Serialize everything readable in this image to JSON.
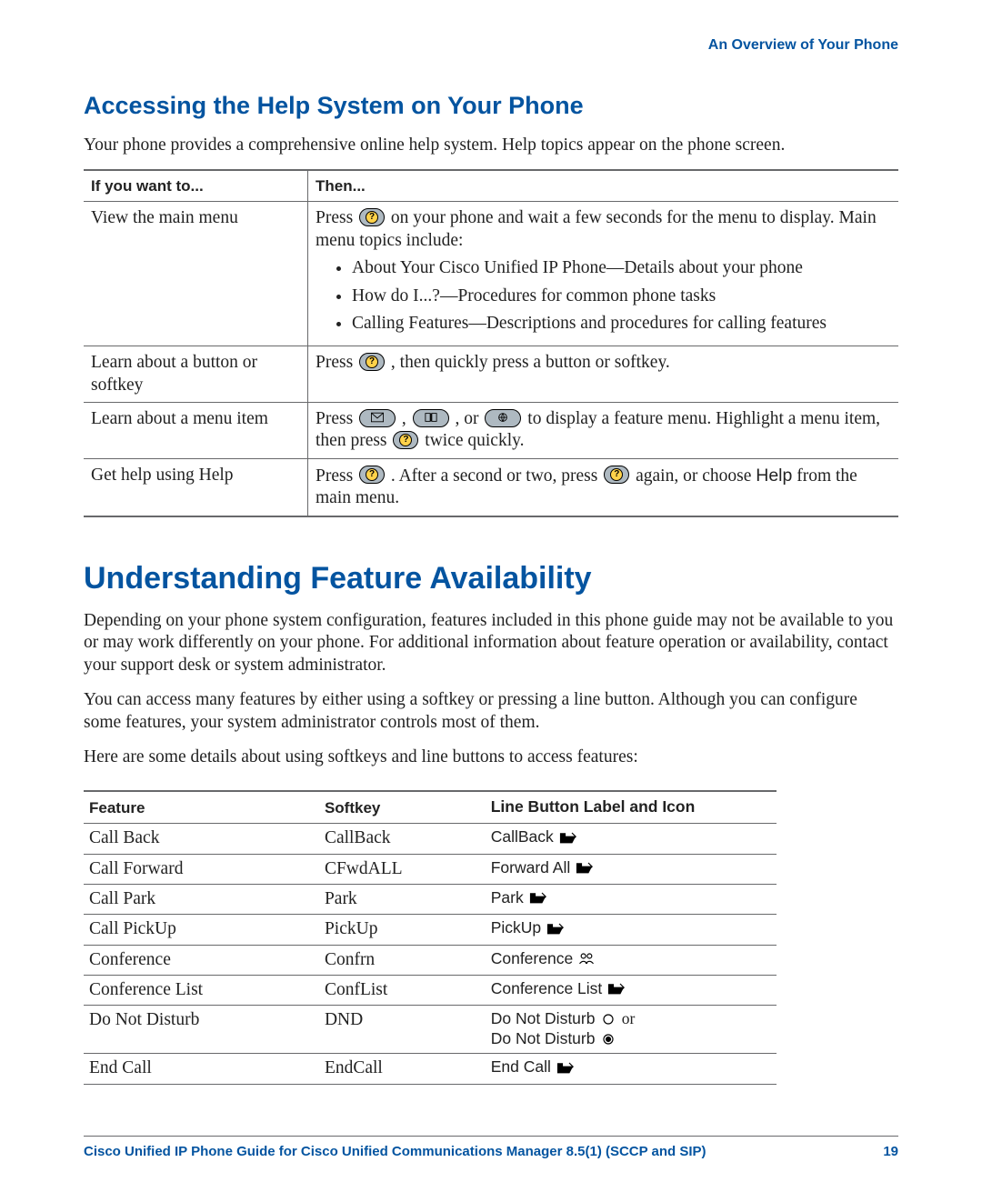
{
  "running_head": "An Overview of Your Phone",
  "section_help": {
    "title": "Accessing the Help System on Your Phone",
    "intro": "Your phone provides a comprehensive online help system. Help topics appear on the phone screen.",
    "table": {
      "headers": [
        "If you want to...",
        "Then..."
      ],
      "rows": {
        "r0": {
          "left": "View the main menu",
          "press_prefix": "Press ",
          "press_suffix": " on your phone and wait a few seconds for the menu to display. Main menu topics include:",
          "topics": [
            "About Your Cisco Unified IP Phone—Details about your phone",
            "How do I...?—Procedures for common phone tasks",
            "Calling Features—Descriptions and procedures for calling features"
          ]
        },
        "r1": {
          "left": "Learn about a button or softkey",
          "press_prefix": "Press ",
          "press_suffix": ", then quickly press a button or softkey."
        },
        "r2": {
          "left": "Learn about a menu item",
          "t1": "Press ",
          "t2": ", ",
          "t3": ", or ",
          "t4": " to display a feature menu. Highlight a menu item, then press ",
          "t5": " twice quickly."
        },
        "r3": {
          "left": "Get help using Help",
          "t1": "Press ",
          "t2": ". After a second or two, press ",
          "t3": " again, or choose ",
          "help_word": "Help",
          "t4": " from the main menu."
        }
      }
    }
  },
  "section_feat": {
    "title": "Understanding Feature Availability",
    "p1": "Depending on your phone system configuration, features included in this phone guide may not be available to you or may work differently on your phone. For additional information about feature operation or availability, contact your support desk or system administrator.",
    "p2": "You can access many features by either using a softkey or pressing a line button. Although you can configure some features, your system administrator controls most of them.",
    "p3": "Here are some details about using softkeys and line buttons to access features:",
    "headers": [
      "Feature",
      "Softkey",
      "Line Button Label and Icon"
    ],
    "rows": [
      {
        "feature": "Call Back",
        "softkey": "CallBack",
        "label": "CallBack",
        "icon": "phone"
      },
      {
        "feature": "Call Forward",
        "softkey": "CFwdALL",
        "label": "Forward All",
        "icon": "phone"
      },
      {
        "feature": "Call Park",
        "softkey": "Park",
        "label": "Park",
        "icon": "phone"
      },
      {
        "feature": "Call PickUp",
        "softkey": "PickUp",
        "label": "PickUp",
        "icon": "phone"
      },
      {
        "feature": "Conference",
        "softkey": "Confrn",
        "label": "Conference",
        "icon": "conference"
      },
      {
        "feature": "Conference List",
        "softkey": "ConfList",
        "label": "Conference List",
        "icon": "phone"
      },
      {
        "feature": "Do Not Disturb",
        "softkey": "DND",
        "label": "Do Not Disturb",
        "icon": "dnd",
        "extra": " or",
        "label2": "Do Not Disturb",
        "icon2": "dnd_on"
      },
      {
        "feature": "End Call",
        "softkey": "EndCall",
        "label": "End Call",
        "icon": "phone"
      }
    ]
  },
  "footer": {
    "title": "Cisco Unified IP Phone Guide for Cisco Unified Communications Manager 8.5(1) (SCCP and SIP)",
    "page": "19"
  }
}
